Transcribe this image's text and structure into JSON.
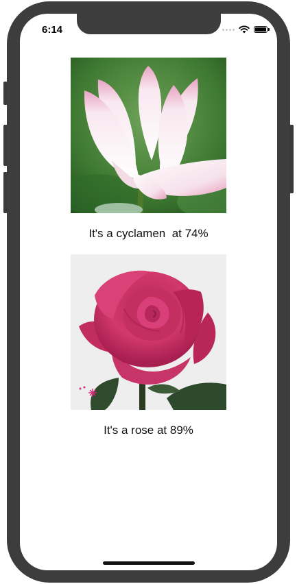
{
  "status_bar": {
    "time": "6:14",
    "icons": [
      "signal-dots-icon",
      "wifi-icon",
      "battery-icon"
    ]
  },
  "results": [
    {
      "image": "white-pink-lotus-photo",
      "caption": "It's a cyclamen  at 74%"
    },
    {
      "image": "pink-rose-photo",
      "caption": "It's a rose at 89%"
    }
  ],
  "colors": {
    "device_frame": "#3d3d3d",
    "screen_background": "#ffffff",
    "text": "#111111"
  }
}
